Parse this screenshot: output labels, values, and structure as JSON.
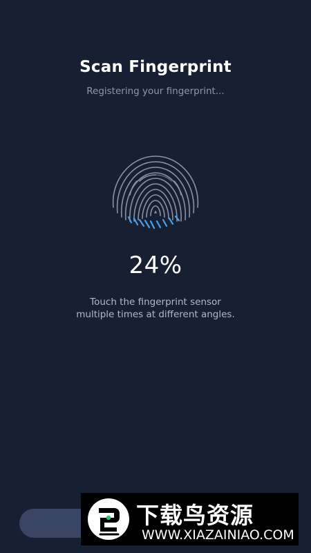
{
  "header": {
    "title": "Scan Fingerprint",
    "subtitle": "Registering your fingerprint..."
  },
  "scan": {
    "progress_percent": 24,
    "progress_label": "24%",
    "icon": "fingerprint-icon",
    "hint_line1": "Touch the fingerprint sensor",
    "hint_line2": "multiple times at different angles."
  },
  "watermark": {
    "chinese_text": "下载鸟资源",
    "url": "WWW.XIAZAINIAO.COM"
  },
  "colors": {
    "background": "#172033",
    "fingerprint_idle": "#8b93a3",
    "fingerprint_progress": "#4d9fe8",
    "button": "#3a4563"
  }
}
